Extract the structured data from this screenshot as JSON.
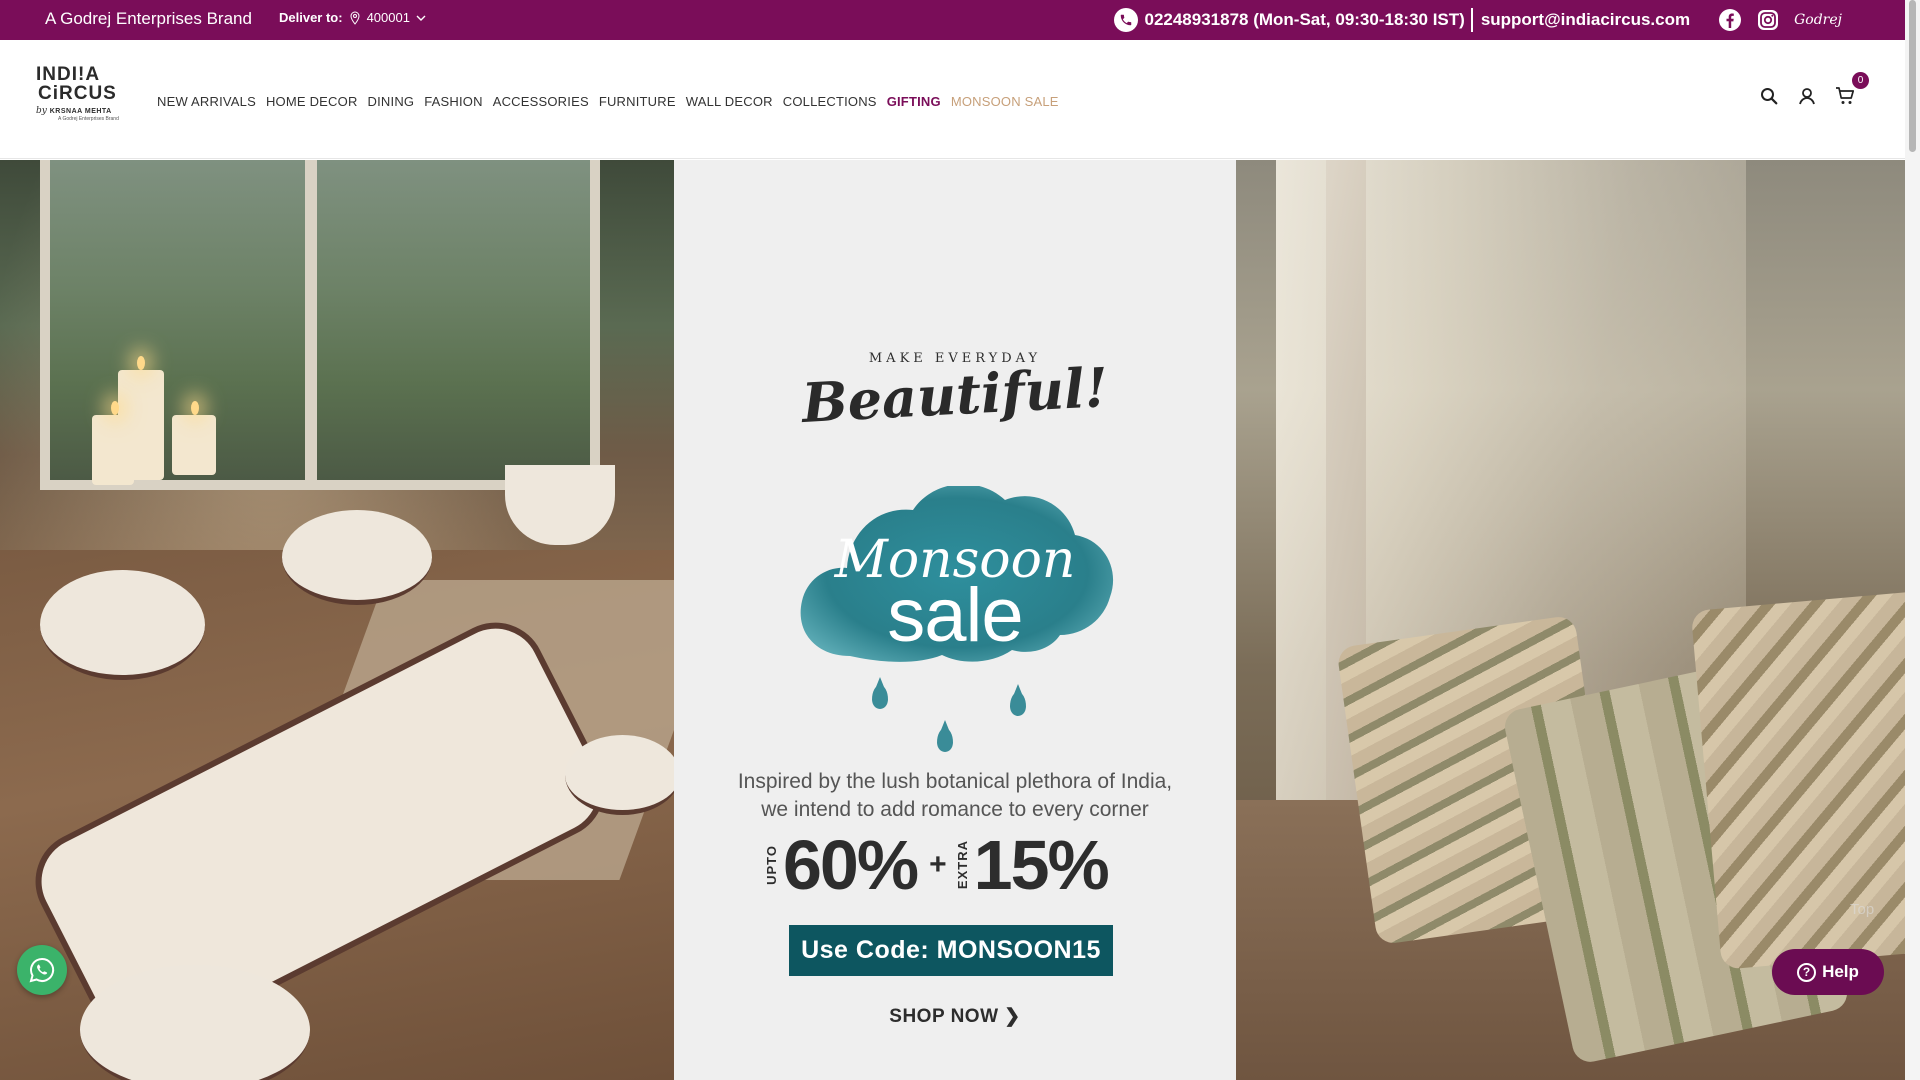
{
  "topbar": {
    "brand": "A Godrej Enterprises Brand",
    "deliver_label": "Deliver to:",
    "pincode": "400001",
    "phone": "02248931878 (Mon-Sat, 09:30-18:30 IST)",
    "email": "support@indiacircus.com",
    "icons": [
      "phone-icon",
      "facebook-icon",
      "instagram-icon",
      "godrej-logo"
    ],
    "godrej_text": "Godrej",
    "bg_color": "#7a0d59"
  },
  "logo": {
    "line1": "INDI!A",
    "line2": "CiRCUS",
    "by": "by",
    "maker": "KRSNAA MEHTA",
    "tag": "A Godrej Enterprises Brand"
  },
  "nav": {
    "items": [
      "NEW ARRIVALS",
      "HOME DECOR",
      "DINING",
      "FASHION",
      "ACCESSORIES",
      "FURNITURE",
      "WALL DECOR",
      "COLLECTIONS",
      "GIFTING",
      "MONSOON SALE"
    ],
    "accent_gifting": "#7a0d59",
    "accent_sale": "#c7a07a"
  },
  "header_icons": {
    "search": "search-icon",
    "account": "user-icon",
    "cart": "cart-icon",
    "cart_count": "0"
  },
  "hero": {
    "eyebrow": "MAKE EVERYDAY",
    "headline": "Beautiful!",
    "monsoon": "Monsoon",
    "sale": "sale",
    "tagline_line1": "Inspired by the lush botanical plethora of India,",
    "tagline_line2": "we intend to add romance to every corner",
    "upto": "UPTO",
    "discount": "60%",
    "plus": "+",
    "extra": "EXTRA",
    "extra_discount": "15%",
    "code": "Use Code: MONSOON15",
    "cta": "SHOP NOW ❯",
    "code_color": "#0d5660"
  },
  "floating": {
    "help": "Help",
    "top": "Top",
    "whatsapp": "whatsapp-icon"
  }
}
